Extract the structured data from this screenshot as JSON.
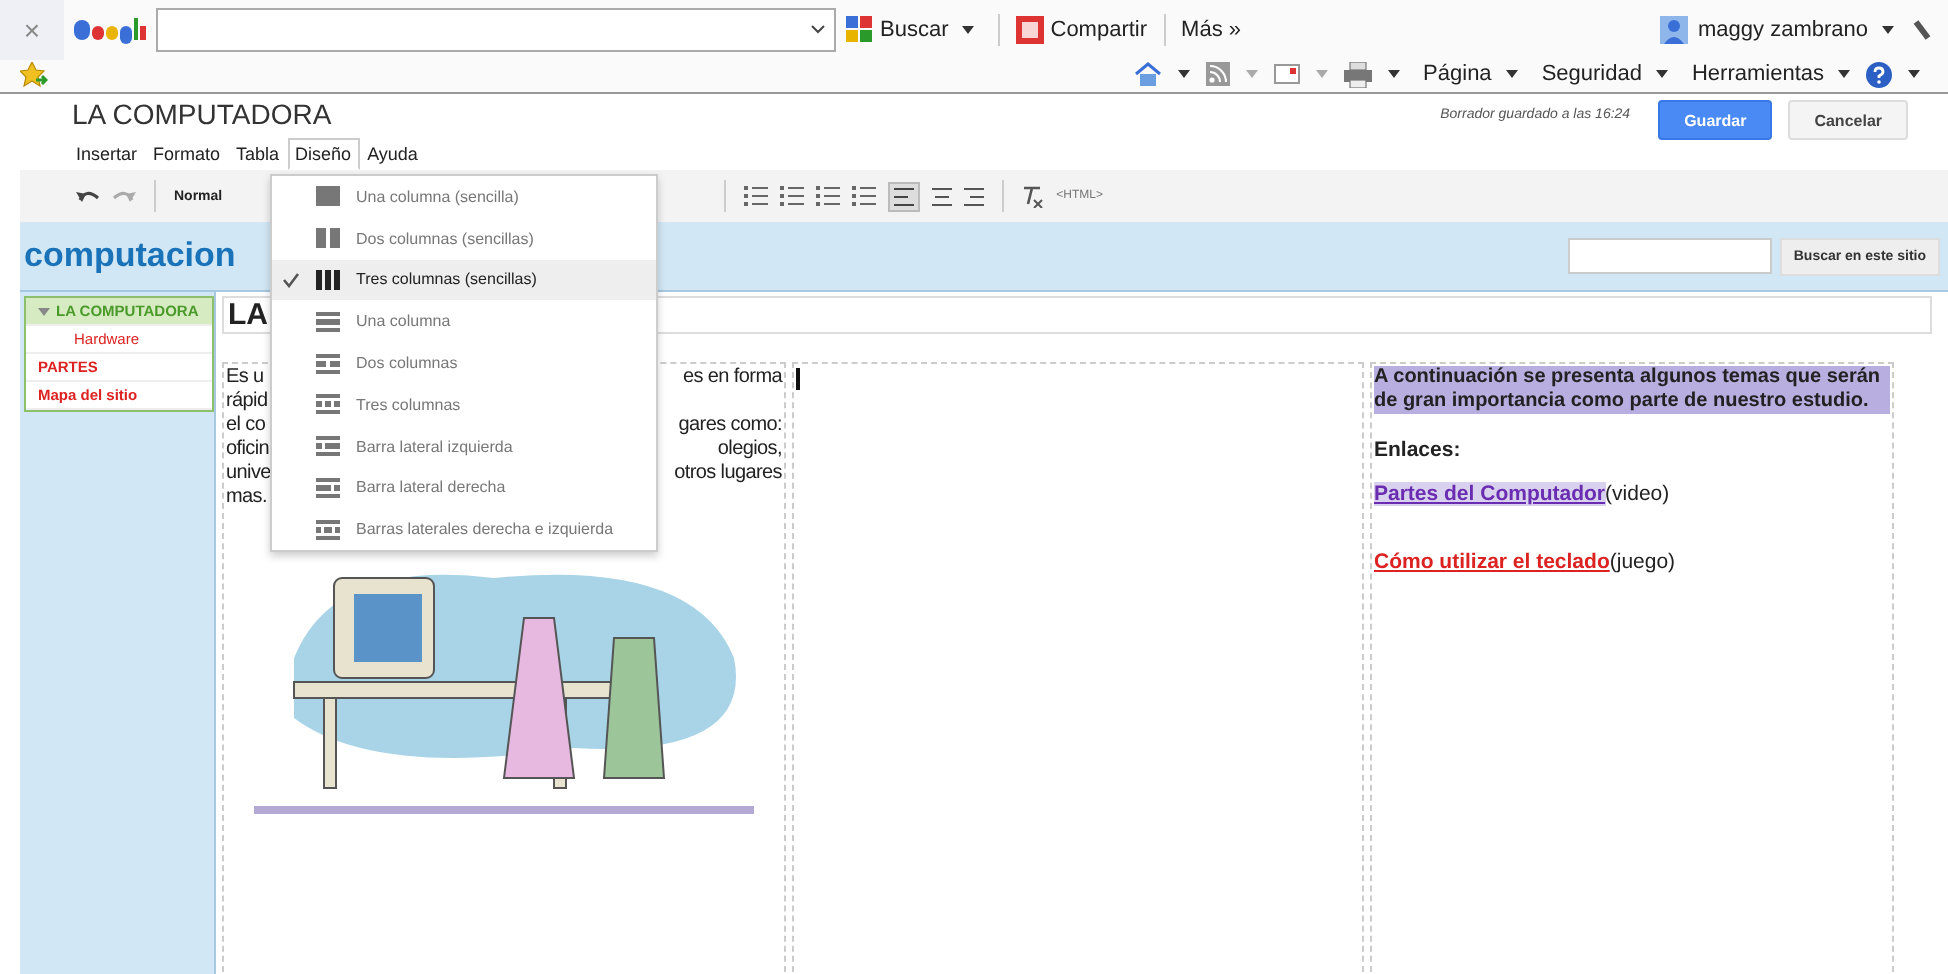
{
  "browser": {
    "close": "×",
    "toolbar_buttons": [
      {
        "label": "Buscar",
        "kind": "search",
        "dropdown": true
      },
      {
        "label": "Compartir",
        "kind": "share",
        "dropdown": false
      },
      {
        "label": "Más »",
        "kind": "more",
        "dropdown": false
      }
    ],
    "user": "maggy zambrano",
    "command_bar": [
      {
        "label": "Página"
      },
      {
        "label": "Seguridad"
      },
      {
        "label": "Herramientas"
      }
    ]
  },
  "editor": {
    "title": "LA COMPUTADORA",
    "status": "Borrador guardado a las 16:24",
    "buttons": [
      {
        "label": "Guardar",
        "kind": "primary"
      },
      {
        "label": "Cancelar",
        "kind": "secondary"
      }
    ],
    "menubar": [
      {
        "label": "Insertar",
        "selected": false
      },
      {
        "label": "Formato",
        "selected": false
      },
      {
        "label": "Tabla",
        "selected": false
      },
      {
        "label": "Diseño",
        "selected": true
      },
      {
        "label": "Ayuda",
        "selected": false
      }
    ],
    "style_select": "Normal",
    "html_button": "<HTML>"
  },
  "layout_menu": [
    {
      "label": "Una columna (sencilla)",
      "kind": "simple1",
      "checked": false
    },
    {
      "label": "Dos columnas (sencillas)",
      "kind": "simple2",
      "checked": false
    },
    {
      "label": "Tres columnas (sencillas)",
      "kind": "simple3",
      "checked": true
    },
    {
      "label": "Una columna",
      "kind": "header1",
      "checked": false
    },
    {
      "label": "Dos columnas",
      "kind": "header2",
      "checked": false
    },
    {
      "label": "Tres columnas",
      "kind": "header3",
      "checked": false
    },
    {
      "label": "Barra lateral izquierda",
      "kind": "left",
      "checked": false
    },
    {
      "label": "Barra lateral derecha",
      "kind": "right",
      "checked": false
    },
    {
      "label": "Barras laterales derecha e izquierda",
      "kind": "both",
      "checked": false
    }
  ],
  "site": {
    "name": "computacion",
    "search_button": "Buscar en este sitio",
    "nav": [
      {
        "label": "LA COMPUTADORA",
        "selected": true,
        "expanded": true,
        "children": [
          {
            "label": "Hardware",
            "selected": false
          }
        ]
      },
      {
        "label": "PARTES",
        "selected": false
      },
      {
        "label": "Mapa del sitio",
        "selected": false
      }
    ]
  },
  "page": {
    "title": "LA",
    "column_1": [
      {
        "left": "Es u",
        "right": "es en forma"
      },
      {
        "left": "rápid"
      },
      {
        "left": "el co",
        "right": "gares como:"
      },
      {
        "left": "oficin",
        "right": "olegios,"
      },
      {
        "left": "unive",
        "right": "otros lugares"
      },
      {
        "left": "mas."
      }
    ],
    "column_3": {
      "intro": "A continuación se presenta algunos temas que serán de gran importancia como parte de  nuestro estudio.",
      "heading": "Enlaces:",
      "links": [
        {
          "label": "Partes del Computador",
          "note": "(video)",
          "visited": true
        },
        {
          "label": "Cómo utilizar el teclado",
          "note": "(juego)",
          "visited": false
        }
      ]
    }
  }
}
